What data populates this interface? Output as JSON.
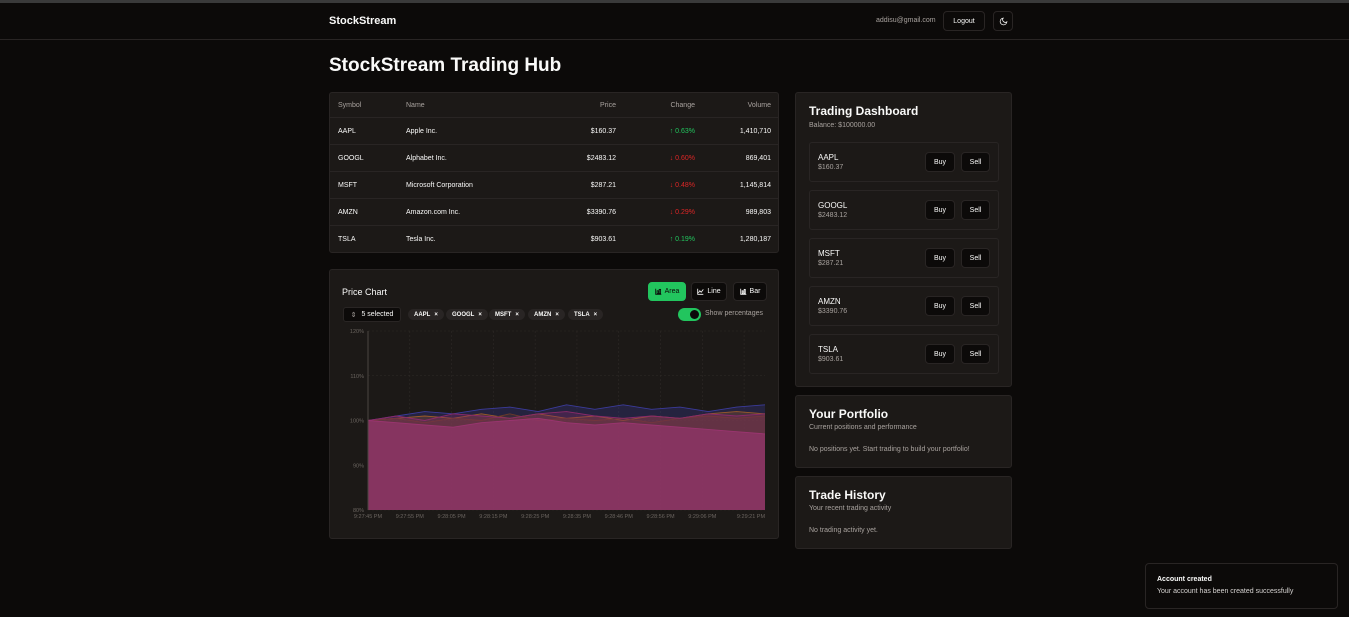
{
  "app": {
    "brand": "StockStream",
    "email": "addisu@gmail.com",
    "logout_label": "Logout",
    "page_title": "StockStream Trading Hub"
  },
  "table": {
    "headers": [
      "Symbol",
      "Name",
      "Price",
      "Change",
      "Volume"
    ],
    "rows": [
      {
        "symbol": "AAPL",
        "name": "Apple Inc.",
        "price": "$160.37",
        "change": "0.63%",
        "dir": "up",
        "volume": "1,410,710"
      },
      {
        "symbol": "GOOGL",
        "name": "Alphabet Inc.",
        "price": "$2483.12",
        "change": "0.60%",
        "dir": "down",
        "volume": "869,401"
      },
      {
        "symbol": "MSFT",
        "name": "Microsoft Corporation",
        "price": "$287.21",
        "change": "0.48%",
        "dir": "down",
        "volume": "1,145,814"
      },
      {
        "symbol": "AMZN",
        "name": "Amazon.com Inc.",
        "price": "$3390.76",
        "change": "0.29%",
        "dir": "down",
        "volume": "989,803"
      },
      {
        "symbol": "TSLA",
        "name": "Tesla Inc.",
        "price": "$903.61",
        "change": "0.19%",
        "dir": "up",
        "volume": "1,280,187"
      }
    ]
  },
  "chart_panel": {
    "title": "Price Chart",
    "types": [
      "Area",
      "Line",
      "Bar"
    ],
    "active_type": "Area",
    "selected_label": "5 selected",
    "chips": [
      "AAPL",
      "GOOGL",
      "MSFT",
      "AMZN",
      "TSLA"
    ],
    "toggle_label": "Show percentages",
    "toggle_on": true
  },
  "chart_data": {
    "type": "area",
    "y_ticks": [
      "120%",
      "110%",
      "100%",
      "90%",
      "80%"
    ],
    "ylim": [
      80,
      120
    ],
    "x_ticks": [
      "9:27:45 PM",
      "9:27:55 PM",
      "9:28:05 PM",
      "9:28:15 PM",
      "9:28:25 PM",
      "9:28:35 PM",
      "9:28:46 PM",
      "9:28:56 PM",
      "9:29:06 PM",
      "9:29:21 PM"
    ],
    "series": [
      {
        "color": "#3b3b9a",
        "values": [
          100,
          101,
          102,
          101.5,
          102.5,
          103,
          102,
          103.5,
          102.5,
          103.5,
          102.5,
          103,
          102,
          103,
          103.5
        ]
      },
      {
        "color": "#9a5a2a",
        "values": [
          100,
          100.5,
          101,
          100.5,
          101.5,
          100.5,
          101.5,
          100.5,
          101,
          100,
          101,
          100.5,
          101.5,
          102,
          101.5
        ]
      },
      {
        "color": "#6a3a2a",
        "values": [
          100,
          100.5,
          99.5,
          100.5,
          100,
          101.5,
          100,
          100.5,
          100,
          100.5,
          99.5,
          100.5,
          101,
          100.5,
          101
        ]
      },
      {
        "color": "#8a2a6a",
        "values": [
          100,
          101,
          100,
          101.5,
          101,
          100.5,
          101.5,
          102,
          101,
          100.5,
          101,
          100.5,
          101.5,
          101,
          101.5
        ]
      },
      {
        "color": "#9a3570",
        "values": [
          100,
          99.5,
          99,
          98.5,
          99.5,
          100,
          100.5,
          99.5,
          99,
          99.5,
          99,
          98.5,
          98,
          97.5,
          97
        ]
      }
    ]
  },
  "dashboard": {
    "title": "Trading Dashboard",
    "balance": "Balance: $100000.00",
    "buy_label": "Buy",
    "sell_label": "Sell",
    "items": [
      {
        "symbol": "AAPL",
        "price": "$160.37"
      },
      {
        "symbol": "GOOGL",
        "price": "$2483.12"
      },
      {
        "symbol": "MSFT",
        "price": "$287.21"
      },
      {
        "symbol": "AMZN",
        "price": "$3390.76"
      },
      {
        "symbol": "TSLA",
        "price": "$903.61"
      }
    ]
  },
  "portfolio": {
    "title": "Your Portfolio",
    "subtitle": "Current positions and performance",
    "empty": "No positions yet. Start trading to build your portfolio!"
  },
  "history": {
    "title": "Trade History",
    "subtitle": "Your recent trading activity",
    "empty": "No trading activity yet."
  },
  "toast": {
    "title": "Account created",
    "description": "Your account has been created successfully"
  }
}
